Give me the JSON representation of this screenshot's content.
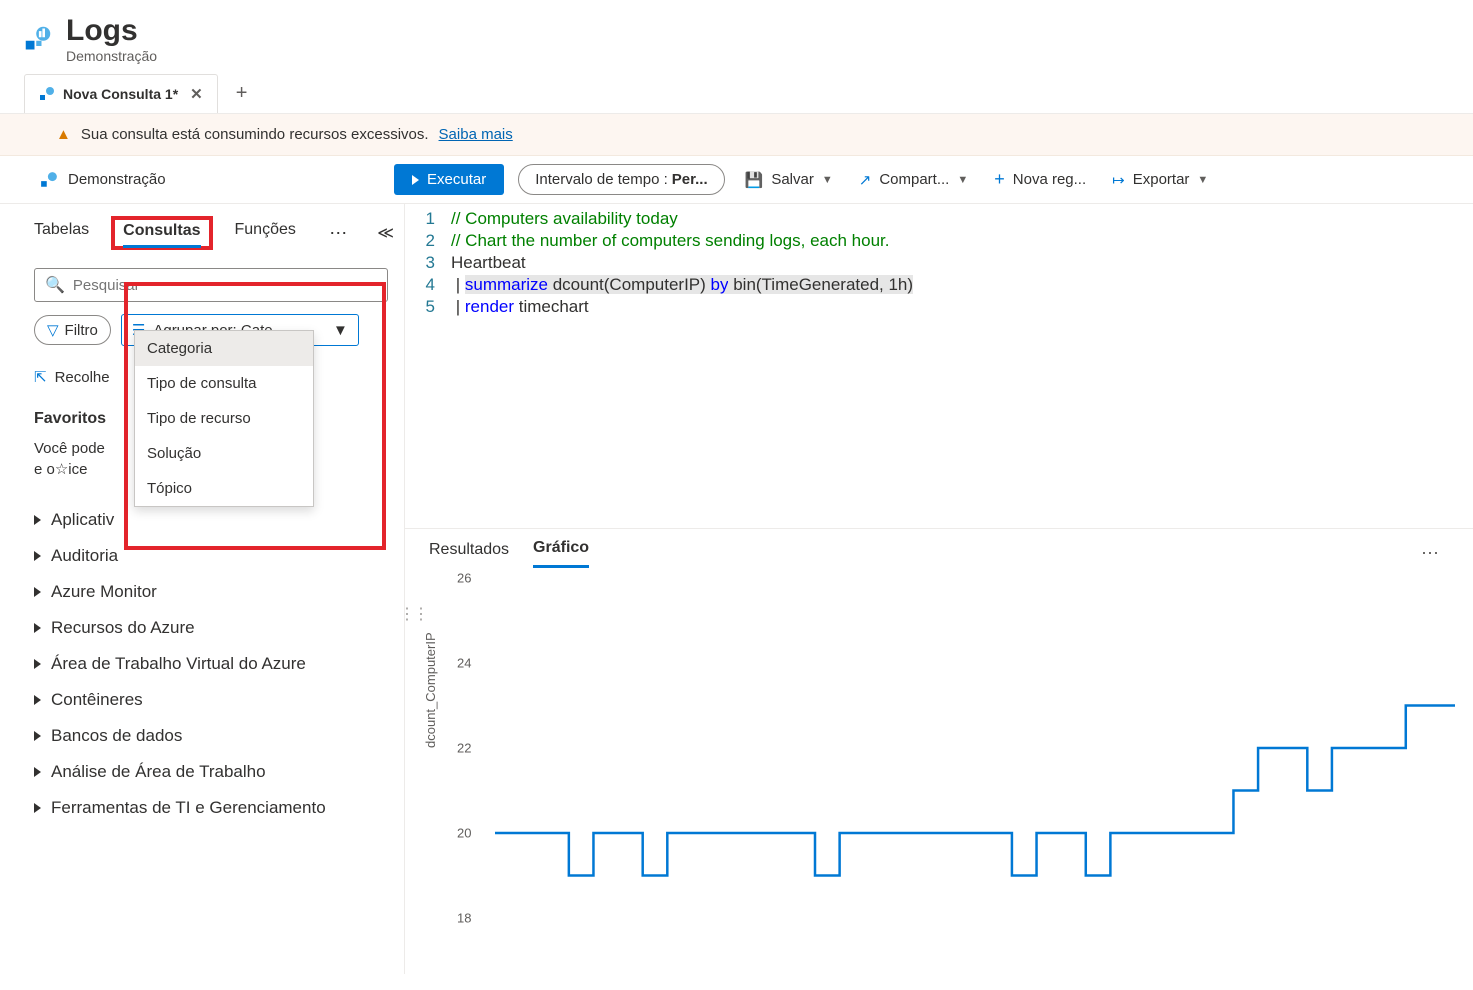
{
  "header": {
    "title": "Logs",
    "subtitle": "Demonstração"
  },
  "tab": {
    "label": "Nova Consulta 1*"
  },
  "warning": {
    "text": "Sua consulta está consumindo recursos excessivos.",
    "link": "Saiba mais"
  },
  "toolbar": {
    "scope": "Demonstração",
    "run": "Executar",
    "time_prefix": "Intervalo de tempo : ",
    "time_value": "Per...",
    "save": "Salvar",
    "share": "Compart...",
    "new": "Nova reg...",
    "export": "Exportar"
  },
  "sidebar": {
    "tabs": {
      "tables": "Tabelas",
      "queries": "Consultas",
      "functions": "Funções"
    },
    "search_placeholder": "Pesquisar",
    "filter": "Filtro",
    "group_by": "Agrupar por: Cate...",
    "dropdown": [
      "Categoria",
      "Tipo de consulta",
      "Tipo de recurso",
      "Solução",
      "Tópico"
    ],
    "collapse_all": "Recolhe",
    "fav_title": "Favoritos",
    "fav_hint1": "Você pode",
    "fav_hint2": "e o☆ice",
    "categories": [
      "Aplicativ",
      "Auditoria",
      "Azure Monitor",
      "Recursos do Azure",
      "Área de Trabalho Virtual do Azure",
      "Contêineres",
      "Bancos de dados",
      "Análise de Área de Trabalho",
      "Ferramentas de TI e Gerenciamento"
    ]
  },
  "editor": {
    "lines": [
      {
        "n": "1",
        "t": "// Computers availability today",
        "cls": "c-comment"
      },
      {
        "n": "2",
        "t": "// Chart the number of computers sending logs, each hour.",
        "cls": "c-comment"
      },
      {
        "n": "3",
        "t": "Heartbeat",
        "cls": ""
      }
    ],
    "line4": {
      "n": "4",
      "kw": "summarize",
      "mid": " dcount(ComputerIP) ",
      "by": "by",
      "tail": " bin(TimeGenerated, 1h)"
    },
    "line5": {
      "n": "5",
      "kw": "render",
      "tail": " timechart"
    }
  },
  "results": {
    "tab_results": "Resultados",
    "tab_chart": "Gráfico"
  },
  "chart_data": {
    "type": "line",
    "ylabel": "dcount_ComputerIP",
    "ylim": [
      18,
      26
    ],
    "yticks": [
      18,
      20,
      22,
      24,
      26
    ],
    "x": [
      0,
      1,
      2,
      3,
      4,
      5,
      6,
      7,
      8,
      9,
      10,
      11,
      12,
      13,
      14,
      15,
      16,
      17,
      18,
      19,
      20,
      21,
      22,
      23,
      24,
      25,
      26,
      27,
      28,
      29,
      30,
      31,
      32,
      33,
      34,
      35,
      36,
      37,
      38,
      39
    ],
    "values": [
      20,
      20,
      20,
      19,
      20,
      20,
      19,
      20,
      20,
      20,
      20,
      20,
      20,
      19,
      20,
      20,
      20,
      20,
      20,
      20,
      20,
      19,
      20,
      20,
      19,
      20,
      20,
      20,
      20,
      20,
      21,
      22,
      22,
      21,
      22,
      22,
      22,
      23,
      23,
      23
    ]
  }
}
